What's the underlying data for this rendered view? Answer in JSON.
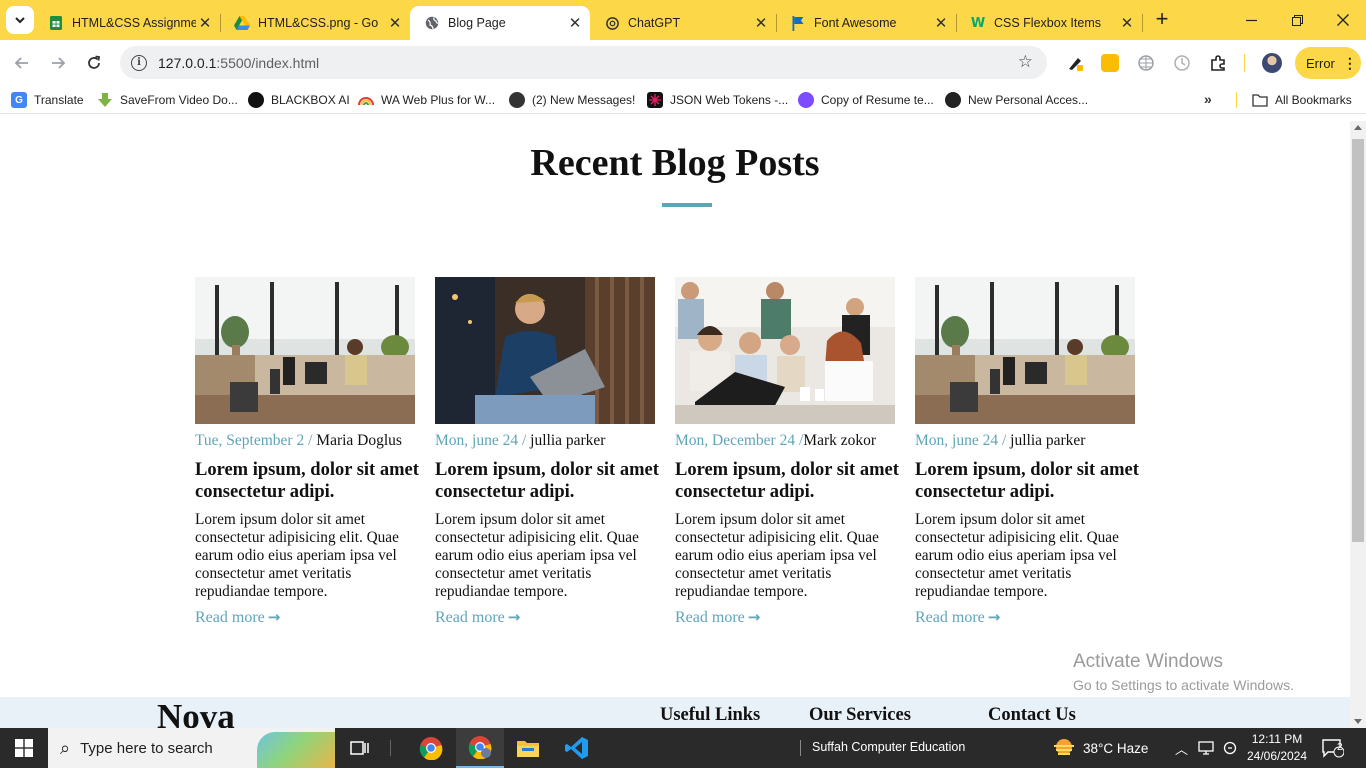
{
  "browser": {
    "tabs": [
      {
        "title": "HTML&CSS Assignme",
        "icon": "google-sheets-icon",
        "active": false
      },
      {
        "title": "HTML&CSS.png - Go",
        "icon": "google-drive-icon",
        "active": false
      },
      {
        "title": "Blog Page",
        "icon": "globe-icon",
        "active": true
      },
      {
        "title": "ChatGPT",
        "icon": "openai-icon",
        "active": false
      },
      {
        "title": "Font Awesome",
        "icon": "flag-icon",
        "active": false
      },
      {
        "title": "CSS Flexbox Items",
        "icon": "w3schools-icon",
        "active": false
      }
    ],
    "url_host": "127.0.0.1",
    "url_path": ":5500/index.html",
    "profile_button": "Error",
    "bookmarks": [
      {
        "label": "Translate",
        "icon": "google-translate-icon"
      },
      {
        "label": "SaveFrom Video Do...",
        "icon": "download-arrow-icon"
      },
      {
        "label": "BLACKBOX AI",
        "icon": "blackbox-icon"
      },
      {
        "label": "WA Web Plus for W...",
        "icon": "rainbow-icon"
      },
      {
        "label": "(2) New Messages!",
        "icon": "messages-icon"
      },
      {
        "label": "JSON Web Tokens -...",
        "icon": "jwt-icon"
      },
      {
        "label": "Copy of Resume te...",
        "icon": "canva-icon"
      },
      {
        "label": "New Personal Acces...",
        "icon": "github-icon"
      }
    ],
    "all_bookmarks": "All Bookmarks"
  },
  "page": {
    "title": "Recent Blog Posts",
    "posts": [
      {
        "date": "Tue, September 2",
        "sep": " / ",
        "author": "Maria Doglus",
        "heading": "Lorem ipsum, dolor sit amet consectetur adipi.",
        "body": "Lorem ipsum dolor sit amet consectetur adipisicing elit. Quae earum odio eius aperiam ipsa vel consectetur amet veritatis repudiandae tempore.",
        "link": "Read more"
      },
      {
        "date": "Mon, june 24",
        "sep": " / ",
        "author": "jullia parker",
        "heading": "Lorem ipsum, dolor sit amet consectetur adipi.",
        "body": "Lorem ipsum dolor sit amet consectetur adipisicing elit. Quae earum odio eius aperiam ipsa vel consectetur amet veritatis repudiandae tempore.",
        "link": "Read more"
      },
      {
        "date": "Mon, December 24",
        "sep": " /",
        "author": "Mark zokor",
        "heading": "Lorem ipsum, dolor sit amet consectetur adipi.",
        "body": "Lorem ipsum dolor sit amet consectetur adipisicing elit. Quae earum odio eius aperiam ipsa vel consectetur amet veritatis repudiandae tempore.",
        "link": "Read more"
      },
      {
        "date": "Mon, june 24",
        "sep": " / ",
        "author": "jullia parker",
        "heading": "Lorem ipsum, dolor sit amet consectetur adipi.",
        "body": "Lorem ipsum dolor sit amet consectetur adipisicing elit. Quae earum odio eius aperiam ipsa vel consectetur amet veritatis repudiandae tempore.",
        "link": "Read more"
      }
    ],
    "footer": {
      "brand": "Nova",
      "useful_links": "Useful Links",
      "our_services": "Our Services",
      "contact_us": "Contact Us"
    },
    "watermark": {
      "line1": "Activate Windows",
      "line2": "Go to Settings to activate Windows."
    }
  },
  "taskbar": {
    "search_placeholder": "Type here to search",
    "window_title": "Suffah Computer Education",
    "weather": "38°C  Haze",
    "time": "12:11 PM",
    "date": "24/06/2024",
    "notifications": "2"
  },
  "colors": {
    "accent": "#5ea5b8",
    "tabstrip": "#fcd848",
    "footer_bg": "#e9f1f8"
  }
}
